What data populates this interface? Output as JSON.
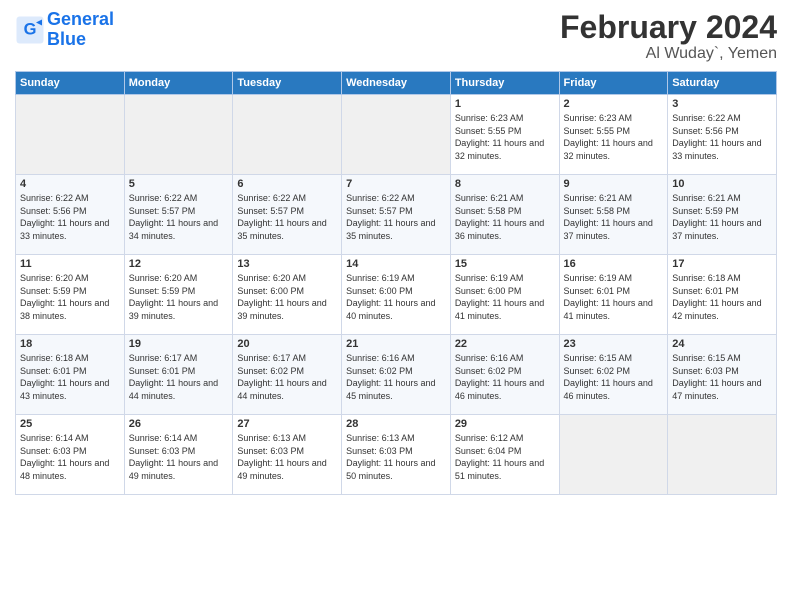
{
  "header": {
    "logo_line1": "General",
    "logo_line2": "Blue",
    "month_year": "February 2024",
    "location": "Al Wuday`, Yemen"
  },
  "days_of_week": [
    "Sunday",
    "Monday",
    "Tuesday",
    "Wednesday",
    "Thursday",
    "Friday",
    "Saturday"
  ],
  "weeks": [
    [
      {
        "num": "",
        "info": ""
      },
      {
        "num": "",
        "info": ""
      },
      {
        "num": "",
        "info": ""
      },
      {
        "num": "",
        "info": ""
      },
      {
        "num": "1",
        "info": "Sunrise: 6:23 AM\nSunset: 5:55 PM\nDaylight: 11 hours and 32 minutes."
      },
      {
        "num": "2",
        "info": "Sunrise: 6:23 AM\nSunset: 5:55 PM\nDaylight: 11 hours and 32 minutes."
      },
      {
        "num": "3",
        "info": "Sunrise: 6:22 AM\nSunset: 5:56 PM\nDaylight: 11 hours and 33 minutes."
      }
    ],
    [
      {
        "num": "4",
        "info": "Sunrise: 6:22 AM\nSunset: 5:56 PM\nDaylight: 11 hours and 33 minutes."
      },
      {
        "num": "5",
        "info": "Sunrise: 6:22 AM\nSunset: 5:57 PM\nDaylight: 11 hours and 34 minutes."
      },
      {
        "num": "6",
        "info": "Sunrise: 6:22 AM\nSunset: 5:57 PM\nDaylight: 11 hours and 35 minutes."
      },
      {
        "num": "7",
        "info": "Sunrise: 6:22 AM\nSunset: 5:57 PM\nDaylight: 11 hours and 35 minutes."
      },
      {
        "num": "8",
        "info": "Sunrise: 6:21 AM\nSunset: 5:58 PM\nDaylight: 11 hours and 36 minutes."
      },
      {
        "num": "9",
        "info": "Sunrise: 6:21 AM\nSunset: 5:58 PM\nDaylight: 11 hours and 37 minutes."
      },
      {
        "num": "10",
        "info": "Sunrise: 6:21 AM\nSunset: 5:59 PM\nDaylight: 11 hours and 37 minutes."
      }
    ],
    [
      {
        "num": "11",
        "info": "Sunrise: 6:20 AM\nSunset: 5:59 PM\nDaylight: 11 hours and 38 minutes."
      },
      {
        "num": "12",
        "info": "Sunrise: 6:20 AM\nSunset: 5:59 PM\nDaylight: 11 hours and 39 minutes."
      },
      {
        "num": "13",
        "info": "Sunrise: 6:20 AM\nSunset: 6:00 PM\nDaylight: 11 hours and 39 minutes."
      },
      {
        "num": "14",
        "info": "Sunrise: 6:19 AM\nSunset: 6:00 PM\nDaylight: 11 hours and 40 minutes."
      },
      {
        "num": "15",
        "info": "Sunrise: 6:19 AM\nSunset: 6:00 PM\nDaylight: 11 hours and 41 minutes."
      },
      {
        "num": "16",
        "info": "Sunrise: 6:19 AM\nSunset: 6:01 PM\nDaylight: 11 hours and 41 minutes."
      },
      {
        "num": "17",
        "info": "Sunrise: 6:18 AM\nSunset: 6:01 PM\nDaylight: 11 hours and 42 minutes."
      }
    ],
    [
      {
        "num": "18",
        "info": "Sunrise: 6:18 AM\nSunset: 6:01 PM\nDaylight: 11 hours and 43 minutes."
      },
      {
        "num": "19",
        "info": "Sunrise: 6:17 AM\nSunset: 6:01 PM\nDaylight: 11 hours and 44 minutes."
      },
      {
        "num": "20",
        "info": "Sunrise: 6:17 AM\nSunset: 6:02 PM\nDaylight: 11 hours and 44 minutes."
      },
      {
        "num": "21",
        "info": "Sunrise: 6:16 AM\nSunset: 6:02 PM\nDaylight: 11 hours and 45 minutes."
      },
      {
        "num": "22",
        "info": "Sunrise: 6:16 AM\nSunset: 6:02 PM\nDaylight: 11 hours and 46 minutes."
      },
      {
        "num": "23",
        "info": "Sunrise: 6:15 AM\nSunset: 6:02 PM\nDaylight: 11 hours and 46 minutes."
      },
      {
        "num": "24",
        "info": "Sunrise: 6:15 AM\nSunset: 6:03 PM\nDaylight: 11 hours and 47 minutes."
      }
    ],
    [
      {
        "num": "25",
        "info": "Sunrise: 6:14 AM\nSunset: 6:03 PM\nDaylight: 11 hours and 48 minutes."
      },
      {
        "num": "26",
        "info": "Sunrise: 6:14 AM\nSunset: 6:03 PM\nDaylight: 11 hours and 49 minutes."
      },
      {
        "num": "27",
        "info": "Sunrise: 6:13 AM\nSunset: 6:03 PM\nDaylight: 11 hours and 49 minutes."
      },
      {
        "num": "28",
        "info": "Sunrise: 6:13 AM\nSunset: 6:03 PM\nDaylight: 11 hours and 50 minutes."
      },
      {
        "num": "29",
        "info": "Sunrise: 6:12 AM\nSunset: 6:04 PM\nDaylight: 11 hours and 51 minutes."
      },
      {
        "num": "",
        "info": ""
      },
      {
        "num": "",
        "info": ""
      }
    ]
  ]
}
